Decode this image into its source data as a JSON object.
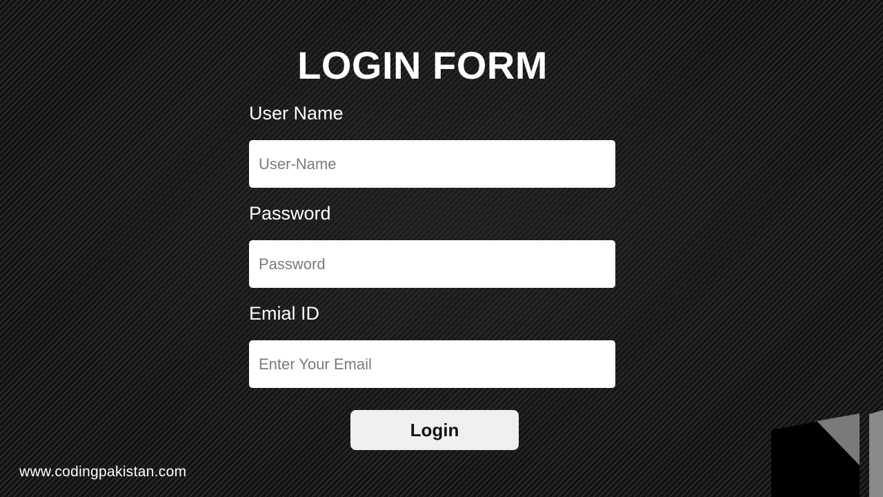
{
  "page": {
    "title": "LOGIN FORM"
  },
  "form": {
    "username": {
      "label": "User Name",
      "placeholder": "User-Name"
    },
    "password": {
      "label": "Password",
      "placeholder": "Password"
    },
    "email": {
      "label": "Emial ID",
      "placeholder": "Enter Your Email"
    },
    "submit_label": "Login"
  },
  "footer": {
    "site_url": "www.codingpakistan.com"
  },
  "decor": {
    "corner_logo_icon": "corner-logo-icon",
    "background_color": "#151515",
    "input_background": "#ffffff",
    "button_background": "#efefef"
  }
}
